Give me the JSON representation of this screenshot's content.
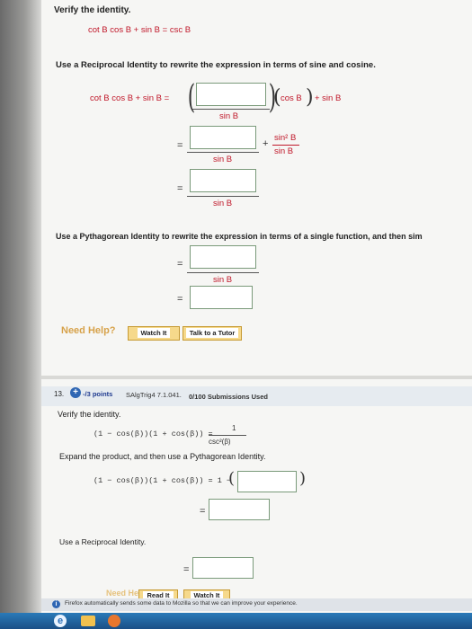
{
  "top": {
    "title": "Verify the identity.",
    "identity": "cot B cos B + sin B = csc B",
    "instruction1": "Use a Reciprocal Identity to rewrite the expression in terms of sine and cosine.",
    "lhs": "cot B cos B + sin B =",
    "cosB": "cos B",
    "plus_sinB": "+ sin B",
    "sinB": "sin B",
    "sin2B": "sin² B",
    "plus": "+",
    "equals": "=",
    "instruction2": "Use a Pythagorean Identity to rewrite the expression in terms of a single function, and then sim",
    "need_help": "Need Help?",
    "watch_it": "Watch It",
    "talk_tutor": "Talk to a Tutor"
  },
  "q13": {
    "number": "13.",
    "points": "-/3 points",
    "source": "SAlgTrig4 7.1.041.",
    "submissions": "0/100 Submissions Used",
    "title": "Verify the identity.",
    "identity_lhs": "(1 − cos(β))(1 + cos(β)) =",
    "frac_num": "1",
    "frac_den": "csc²(β)",
    "instruction1": "Expand the product, and then use a Pythagorean Identity.",
    "expr": "(1 − cos(β))(1 + cos(β)) = 1 −",
    "equals": "=",
    "instruction2": "Use a Reciprocal Identity.",
    "need_help": "Need Help?",
    "read_it": "Read It",
    "watch_it": "Watch It"
  },
  "footer": {
    "notice": "Firefox automatically sends some data to Mozilla so that we can improve your experience."
  },
  "colors": {
    "math_red": "#c0182a",
    "button_gold": "#f6d98b",
    "accent_blue": "#1f3a5f"
  }
}
